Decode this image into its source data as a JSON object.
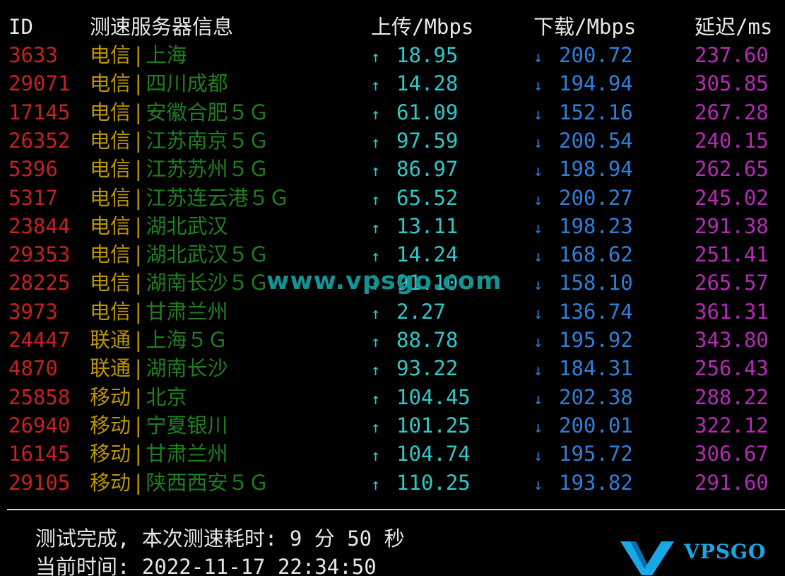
{
  "header": {
    "id": "ID",
    "server": "测速服务器信息",
    "upload": "上传/Mbps",
    "download": "下载/Mbps",
    "latency": "延迟/ms"
  },
  "rows": [
    {
      "id": "3633",
      "isp": "电信",
      "loc": "上海",
      "up": "18.95",
      "down": "200.72",
      "lat": "237.60"
    },
    {
      "id": "29071",
      "isp": "电信",
      "loc": "四川成都",
      "up": "14.28",
      "down": "194.94",
      "lat": "305.85"
    },
    {
      "id": "17145",
      "isp": "电信",
      "loc": "安徽合肥５Ｇ",
      "up": "61.09",
      "down": "152.16",
      "lat": "267.28"
    },
    {
      "id": "26352",
      "isp": "电信",
      "loc": "江苏南京５Ｇ",
      "up": "97.59",
      "down": "200.54",
      "lat": "240.15"
    },
    {
      "id": "5396",
      "isp": "电信",
      "loc": "江苏苏州５Ｇ",
      "up": "86.97",
      "down": "198.94",
      "lat": "262.65"
    },
    {
      "id": "5317",
      "isp": "电信",
      "loc": "江苏连云港５Ｇ",
      "up": "65.52",
      "down": "200.27",
      "lat": "245.02"
    },
    {
      "id": "23844",
      "isp": "电信",
      "loc": "湖北武汉",
      "up": "13.11",
      "down": "198.23",
      "lat": "291.38"
    },
    {
      "id": "29353",
      "isp": "电信",
      "loc": "湖北武汉５Ｇ",
      "up": "14.24",
      "down": "168.62",
      "lat": "251.41"
    },
    {
      "id": "28225",
      "isp": "电信",
      "loc": "湖南长沙５Ｇ",
      "up": "91.10",
      "down": "158.10",
      "lat": "265.57"
    },
    {
      "id": "3973",
      "isp": "电信",
      "loc": "甘肃兰州",
      "up": "2.27",
      "down": "136.74",
      "lat": "361.31"
    },
    {
      "id": "24447",
      "isp": "联通",
      "loc": "上海５Ｇ",
      "up": "88.78",
      "down": "195.92",
      "lat": "343.80"
    },
    {
      "id": "4870",
      "isp": "联通",
      "loc": "湖南长沙",
      "up": "93.22",
      "down": "184.31",
      "lat": "256.43"
    },
    {
      "id": "25858",
      "isp": "移动",
      "loc": "北京",
      "up": "104.45",
      "down": "202.38",
      "lat": "288.22"
    },
    {
      "id": "26940",
      "isp": "移动",
      "loc": "宁夏银川",
      "up": "101.25",
      "down": "200.01",
      "lat": "322.12"
    },
    {
      "id": "16145",
      "isp": "移动",
      "loc": "甘肃兰州",
      "up": "104.74",
      "down": "195.72",
      "lat": "306.67"
    },
    {
      "id": "29105",
      "isp": "移动",
      "loc": "陕西西安５Ｇ",
      "up": "110.25",
      "down": "193.82",
      "lat": "291.60"
    }
  ],
  "arrows": {
    "up": "↑",
    "down": "↓"
  },
  "separator": "|",
  "watermark": "www.vpsgo.com",
  "footer": {
    "line1": "测试完成, 本次测速耗时: 9 分 50 秒",
    "line2": "当前时间: 2022-11-17 22:34:50"
  },
  "logo": {
    "text": "VPSGO",
    "icon": "v-logo-icon"
  },
  "colors": {
    "id": "#c52121",
    "isp": "#b99500",
    "location": "#1f7f1f",
    "upload": "#2fc8c8",
    "download": "#2f7fd8",
    "latency": "#b42ab4",
    "watermark": "#139494",
    "logo": "#18a8e8"
  }
}
